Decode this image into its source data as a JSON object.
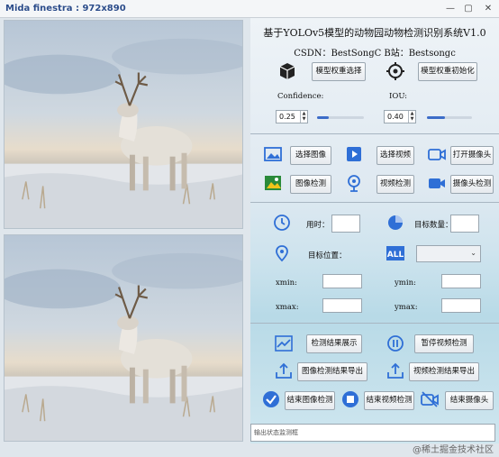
{
  "window": {
    "title": "Mida finestra : 972x890",
    "minimize": "—",
    "maximize": "▢",
    "close": "✕"
  },
  "header": {
    "title": "基于YOLOv5模型的动物园动物检测识别系统V1.0",
    "csdn": "CSDN：BestSongC    B站：Bestsongc"
  },
  "model": {
    "select_button": "模型权重选择",
    "init_button": "模型权重初始化",
    "confidence_label": "Confidence:",
    "iou_label": "IOU:",
    "confidence_value": "0.25",
    "iou_value": "0.40",
    "confidence_level": 0.25,
    "iou_level": 0.4
  },
  "detect": {
    "select_image": "选择图像",
    "select_video": "选择视频",
    "open_camera": "打开摄像头",
    "image_detect": "图像检测",
    "video_detect": "视频检测",
    "camera_detect": "摄像头检测"
  },
  "info": {
    "time_label": "用时：",
    "count_label": "目标数量：",
    "position_label": "目标位置：",
    "xmin_label": "xmin:",
    "ymin_label": "ymin:",
    "xmax_label": "xmax:",
    "ymax_label": "ymax:"
  },
  "actions": {
    "show_result": "检测结果展示",
    "pause_video": "暂停视频检测",
    "export_image": "图像检测结果导出",
    "export_video": "视频检测结果导出",
    "end_image": "结束图像检测",
    "end_video": "结束视频检测",
    "end_camera": "结束摄像头"
  },
  "status": {
    "placeholder": "输出状态监测框"
  },
  "watermark": "@稀土掘金技术社区",
  "colors": {
    "accent": "#3c6cc8",
    "icon_blue": "#2f6fd6"
  }
}
